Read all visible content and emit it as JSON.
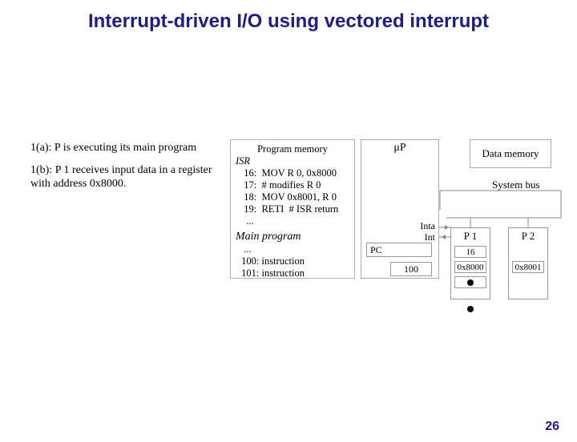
{
  "title": "Interrupt-driven I/O using vectored interrupt",
  "steps": {
    "a": "1(a): P is executing its main program",
    "b": "1(b): P 1 receives input data in a register with address 0x8000."
  },
  "progmem": {
    "header": "Program memory",
    "isr_label": "ISR",
    "lines": {
      "l16": "  16:  MOV R 0, 0x8000",
      "l17": "  17:  # modifies R 0",
      "l18": "  18:  MOV 0x8001, R 0",
      "l19": "  19:  RETI  # ISR return",
      "ldots1": "   ..."
    },
    "mp_label": "Main program",
    "mp": {
      "blank": "  ...",
      "m100": " 100: instruction",
      "m101": " 101: instruction"
    }
  },
  "mu": {
    "label": "μP",
    "inta": "Inta",
    "int": "Int",
    "pc": "PC",
    "pcval": "100"
  },
  "datamem": "Data memory",
  "sysbus": "System bus",
  "p1": {
    "name": "P 1",
    "vec": "16",
    "addr": "0x8000"
  },
  "p2": {
    "name": "P 2",
    "addr": "0x8001"
  },
  "slide": "26"
}
